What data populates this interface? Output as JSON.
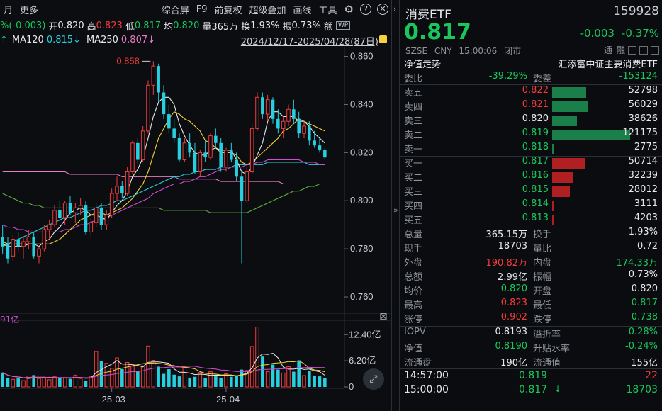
{
  "toolbar": {
    "left": [
      "月",
      "更多"
    ],
    "right": [
      "综合屏",
      "F9",
      "前复权",
      "超级叠加",
      "画线",
      "工具"
    ]
  },
  "ohlc": {
    "chg": "%(-0.003)",
    "open_label": "开",
    "open": "0.820",
    "high_label": "高",
    "high": "0.823",
    "low_label": "低",
    "low": "0.817",
    "avg_label": "均",
    "avg": "0.820",
    "vol_label": "量",
    "vol": "365万",
    "turn_label": "换",
    "turn": "1.93%",
    "amp_label": "振",
    "amp": "0.73%",
    "amt_label": "额"
  },
  "ma": {
    "arrow": "↑",
    "ma120_label": "MA120",
    "ma120": "0.815↓",
    "ma250_label": "MA250",
    "ma250": "0.807↓"
  },
  "date_range": "2024/12/17-2025/04/28(87日)",
  "colors": {
    "up": "#f23b3b",
    "down": "#25d1e0",
    "green": "#19c75c",
    "bg": "#0b0c0f"
  },
  "chart_data": {
    "type": "candlestick",
    "y_ticks": [
      "0.860",
      "0.840",
      "0.820",
      "0.800",
      "0.780",
      "0.760"
    ],
    "ylim": [
      0.755,
      0.864
    ],
    "max_annotation": "0.858",
    "x_ticks": [
      "25-03",
      "25-04"
    ],
    "candles": [
      [
        0.785,
        0.79,
        0.778,
        0.781
      ],
      [
        0.782,
        0.785,
        0.774,
        0.776
      ],
      [
        0.777,
        0.786,
        0.775,
        0.784
      ],
      [
        0.784,
        0.787,
        0.779,
        0.781
      ],
      [
        0.781,
        0.785,
        0.776,
        0.783
      ],
      [
        0.783,
        0.788,
        0.78,
        0.785
      ],
      [
        0.785,
        0.787,
        0.776,
        0.777
      ],
      [
        0.777,
        0.781,
        0.774,
        0.78
      ],
      [
        0.78,
        0.79,
        0.779,
        0.788
      ],
      [
        0.788,
        0.792,
        0.784,
        0.79
      ],
      [
        0.79,
        0.798,
        0.789,
        0.796
      ],
      [
        0.796,
        0.8,
        0.792,
        0.793
      ],
      [
        0.793,
        0.8,
        0.79,
        0.799
      ],
      [
        0.799,
        0.802,
        0.794,
        0.795
      ],
      [
        0.795,
        0.799,
        0.791,
        0.797
      ],
      [
        0.797,
        0.801,
        0.794,
        0.798
      ],
      [
        0.798,
        0.8,
        0.786,
        0.787
      ],
      [
        0.787,
        0.793,
        0.785,
        0.791
      ],
      [
        0.791,
        0.799,
        0.789,
        0.797
      ],
      [
        0.797,
        0.799,
        0.788,
        0.79
      ],
      [
        0.79,
        0.796,
        0.788,
        0.794
      ],
      [
        0.794,
        0.805,
        0.793,
        0.803
      ],
      [
        0.803,
        0.81,
        0.8,
        0.806
      ],
      [
        0.806,
        0.808,
        0.801,
        0.803
      ],
      [
        0.803,
        0.814,
        0.802,
        0.812
      ],
      [
        0.812,
        0.825,
        0.811,
        0.824
      ],
      [
        0.824,
        0.826,
        0.815,
        0.817
      ],
      [
        0.817,
        0.831,
        0.816,
        0.829
      ],
      [
        0.829,
        0.85,
        0.828,
        0.848
      ],
      [
        0.848,
        0.858,
        0.844,
        0.856
      ],
      [
        0.856,
        0.857,
        0.841,
        0.845
      ],
      [
        0.845,
        0.848,
        0.834,
        0.836
      ],
      [
        0.836,
        0.84,
        0.828,
        0.83
      ],
      [
        0.83,
        0.834,
        0.824,
        0.826
      ],
      [
        0.826,
        0.828,
        0.816,
        0.817
      ],
      [
        0.817,
        0.826,
        0.816,
        0.824
      ],
      [
        0.824,
        0.828,
        0.818,
        0.82
      ],
      [
        0.82,
        0.824,
        0.811,
        0.812
      ],
      [
        0.812,
        0.821,
        0.81,
        0.82
      ],
      [
        0.82,
        0.825,
        0.816,
        0.818
      ],
      [
        0.818,
        0.828,
        0.817,
        0.827
      ],
      [
        0.827,
        0.83,
        0.822,
        0.824
      ],
      [
        0.824,
        0.826,
        0.812,
        0.814
      ],
      [
        0.814,
        0.822,
        0.812,
        0.821
      ],
      [
        0.821,
        0.824,
        0.816,
        0.817
      ],
      [
        0.817,
        0.82,
        0.808,
        0.81
      ],
      [
        0.81,
        0.812,
        0.774,
        0.8
      ],
      [
        0.8,
        0.814,
        0.799,
        0.812
      ],
      [
        0.812,
        0.832,
        0.811,
        0.83
      ],
      [
        0.83,
        0.845,
        0.829,
        0.843
      ],
      [
        0.843,
        0.845,
        0.834,
        0.836
      ],
      [
        0.836,
        0.844,
        0.833,
        0.842
      ],
      [
        0.842,
        0.843,
        0.832,
        0.834
      ],
      [
        0.834,
        0.838,
        0.828,
        0.83
      ],
      [
        0.83,
        0.835,
        0.826,
        0.833
      ],
      [
        0.833,
        0.84,
        0.831,
        0.838
      ],
      [
        0.838,
        0.842,
        0.832,
        0.834
      ],
      [
        0.834,
        0.837,
        0.826,
        0.828
      ],
      [
        0.828,
        0.833,
        0.826,
        0.831
      ],
      [
        0.831,
        0.833,
        0.823,
        0.825
      ],
      [
        0.825,
        0.829,
        0.822,
        0.823
      ],
      [
        0.823,
        0.826,
        0.82,
        0.821
      ],
      [
        0.821,
        0.822,
        0.817,
        0.818
      ]
    ],
    "ma5": [
      0.782,
      0.781,
      0.781,
      0.781,
      0.781,
      0.782,
      0.782,
      0.781,
      0.783,
      0.784,
      0.787,
      0.789,
      0.792,
      0.795,
      0.796,
      0.797,
      0.796,
      0.794,
      0.794,
      0.793,
      0.792,
      0.795,
      0.798,
      0.8,
      0.804,
      0.81,
      0.813,
      0.818,
      0.826,
      0.835,
      0.841,
      0.843,
      0.843,
      0.84,
      0.832,
      0.827,
      0.823,
      0.82,
      0.819,
      0.819,
      0.821,
      0.822,
      0.821,
      0.821,
      0.821,
      0.817,
      0.812,
      0.811,
      0.814,
      0.819,
      0.824,
      0.833,
      0.837,
      0.837,
      0.835,
      0.835,
      0.835,
      0.833,
      0.833,
      0.831,
      0.828,
      0.826,
      0.824
    ],
    "ma10": [
      0.783,
      0.782,
      0.782,
      0.782,
      0.782,
      0.782,
      0.782,
      0.782,
      0.782,
      0.782,
      0.783,
      0.784,
      0.786,
      0.788,
      0.79,
      0.792,
      0.793,
      0.794,
      0.795,
      0.795,
      0.794,
      0.795,
      0.796,
      0.797,
      0.799,
      0.801,
      0.804,
      0.807,
      0.812,
      0.819,
      0.826,
      0.83,
      0.834,
      0.837,
      0.836,
      0.834,
      0.833,
      0.831,
      0.829,
      0.825,
      0.824,
      0.822,
      0.82,
      0.82,
      0.82,
      0.819,
      0.816,
      0.815,
      0.816,
      0.818,
      0.82,
      0.822,
      0.824,
      0.826,
      0.829,
      0.83,
      0.832,
      0.834,
      0.833,
      0.832,
      0.831,
      0.83,
      0.829
    ],
    "ma60": [
      0.79,
      0.789,
      0.789,
      0.788,
      0.788,
      0.787,
      0.787,
      0.787,
      0.787,
      0.787,
      0.787,
      0.787,
      0.788,
      0.788,
      0.789,
      0.79,
      0.79,
      0.791,
      0.792,
      0.792,
      0.793,
      0.794,
      0.795,
      0.796,
      0.797,
      0.798,
      0.799,
      0.8,
      0.801,
      0.803,
      0.804,
      0.805,
      0.806,
      0.807,
      0.807,
      0.808,
      0.808,
      0.809,
      0.81,
      0.81,
      0.811,
      0.812,
      0.813,
      0.813,
      0.814,
      0.814,
      0.814,
      0.815,
      0.815,
      0.816,
      0.816,
      0.817,
      0.817,
      0.817,
      0.817,
      0.817,
      0.817,
      0.817,
      0.816,
      0.816,
      0.816,
      0.815,
      0.815
    ],
    "ma120": [
      0.781,
      0.782,
      0.783,
      0.784,
      0.785,
      0.786,
      0.787,
      0.788,
      0.789,
      0.79,
      0.791,
      0.792,
      0.793,
      0.793,
      0.794,
      0.795,
      0.796,
      0.796,
      0.797,
      0.798,
      0.798,
      0.799,
      0.8,
      0.8,
      0.801,
      0.802,
      0.803,
      0.804,
      0.805,
      0.806,
      0.807,
      0.808,
      0.809,
      0.81,
      0.81,
      0.811,
      0.811,
      0.812,
      0.812,
      0.813,
      0.813,
      0.813,
      0.814,
      0.814,
      0.814,
      0.815,
      0.815,
      0.815,
      0.815,
      0.815,
      0.815,
      0.816,
      0.816,
      0.816,
      0.816,
      0.816,
      0.816,
      0.816,
      0.816,
      0.815,
      0.815,
      0.815,
      0.815
    ],
    "ma250": [
      0.812,
      0.812,
      0.812,
      0.812,
      0.812,
      0.812,
      0.812,
      0.812,
      0.812,
      0.812,
      0.812,
      0.812,
      0.812,
      0.811,
      0.811,
      0.811,
      0.811,
      0.811,
      0.811,
      0.811,
      0.811,
      0.811,
      0.811,
      0.81,
      0.81,
      0.81,
      0.81,
      0.81,
      0.81,
      0.81,
      0.81,
      0.81,
      0.81,
      0.81,
      0.809,
      0.809,
      0.809,
      0.809,
      0.809,
      0.809,
      0.809,
      0.809,
      0.808,
      0.808,
      0.808,
      0.808,
      0.808,
      0.808,
      0.808,
      0.808,
      0.808,
      0.808,
      0.808,
      0.808,
      0.807,
      0.807,
      0.807,
      0.807,
      0.807,
      0.807,
      0.807,
      0.807,
      0.807
    ],
    "ma_green": [
      0.803,
      0.802,
      0.801,
      0.8,
      0.799,
      0.799,
      0.798,
      0.798,
      0.797,
      0.797,
      0.797,
      0.797,
      0.797,
      0.797,
      0.797,
      0.797,
      0.797,
      0.797,
      0.797,
      0.797,
      0.797,
      0.797,
      0.797,
      0.797,
      0.797,
      0.797,
      0.797,
      0.797,
      0.797,
      0.797,
      0.797,
      0.796,
      0.796,
      0.796,
      0.796,
      0.796,
      0.796,
      0.796,
      0.796,
      0.796,
      0.795,
      0.795,
      0.795,
      0.795,
      0.795,
      0.795,
      0.795,
      0.795,
      0.796,
      0.797,
      0.798,
      0.799,
      0.8,
      0.801,
      0.802,
      0.803,
      0.804,
      0.804,
      0.805,
      0.806,
      0.806,
      0.807,
      0.807
    ],
    "vol_label": "91亿",
    "vol_ticks": [
      "12.40亿",
      "6.20亿",
      "0"
    ],
    "volumes": [
      3.4,
      2.2,
      1.8,
      2.0,
      1.5,
      2.6,
      2.8,
      2.0,
      2.3,
      1.7,
      2.4,
      2.1,
      2.2,
      1.9,
      2.8,
      2.0,
      1.4,
      2.5,
      8.4,
      6.1,
      5.6,
      4.4,
      6.9,
      4.2,
      5.8,
      4.9,
      3.8,
      5.0,
      9.7,
      6.3,
      4.8,
      3.1,
      4.2,
      2.9,
      2.5,
      4.6,
      2.2,
      2.4,
      3.4,
      2.1,
      3.6,
      2.5,
      2.2,
      3.1,
      2.4,
      2.6,
      4.1,
      3.9,
      9.6,
      14.2,
      7.2,
      3.6,
      5.3,
      4.1,
      3.3,
      4.8,
      3.6,
      6.3,
      2.7,
      3.8,
      2.7,
      2.5,
      2.1
    ]
  },
  "quote": {
    "name": "消费ETF",
    "code": "159928",
    "price": "0.817",
    "chg": "-0.003",
    "pct": "-0.37%",
    "market": "SZSE",
    "currency": "CNY",
    "time": "15:00:06",
    "status": "闭市",
    "tags": [
      "通",
      "融"
    ],
    "nav_label": "净值走势",
    "fund_name": "汇添富中证主要消费ETF",
    "weibi_label": "委比",
    "weibi": "-39.29%",
    "weicha_label": "委差",
    "weicha": "-153124"
  },
  "sells": [
    {
      "label": "卖五",
      "price": "0.822",
      "qty": "52798",
      "color": "#f23b3b",
      "bar": 0.44
    },
    {
      "label": "卖四",
      "price": "0.821",
      "qty": "56029",
      "color": "#f23b3b",
      "bar": 0.46
    },
    {
      "label": "卖三",
      "price": "0.820",
      "qty": "38626",
      "color": "#e6e8eb",
      "bar": 0.32
    },
    {
      "label": "卖二",
      "price": "0.819",
      "qty": "121175",
      "color": "#19c75c",
      "bar": 1.0
    },
    {
      "label": "卖一",
      "price": "0.818",
      "qty": "2775",
      "color": "#19c75c",
      "bar": 0.02
    }
  ],
  "buys": [
    {
      "label": "买一",
      "price": "0.817",
      "qty": "50714",
      "color": "#19c75c",
      "bar": 0.42
    },
    {
      "label": "买二",
      "price": "0.816",
      "qty": "32239",
      "color": "#19c75c",
      "bar": 0.27
    },
    {
      "label": "买三",
      "price": "0.815",
      "qty": "28012",
      "color": "#19c75c",
      "bar": 0.23
    },
    {
      "label": "买四",
      "price": "0.814",
      "qty": "3111",
      "color": "#19c75c",
      "bar": 0.03
    },
    {
      "label": "买五",
      "price": "0.813",
      "qty": "4203",
      "color": "#19c75c",
      "bar": 0.03
    }
  ],
  "stats": [
    {
      "l1": "总量",
      "v1": "365.15万",
      "c1": "#e6e8eb",
      "l2": "换手",
      "v2": "1.93%",
      "c2": "#e6e8eb"
    },
    {
      "l1": "现手",
      "v1": "18703",
      "c1": "#e6e8eb",
      "l2": "量比",
      "v2": "0.72",
      "c2": "#e6e8eb"
    },
    {
      "l1": "外盘",
      "v1": "190.82万",
      "c1": "#f23b3b",
      "l2": "内盘",
      "v2": "174.33万",
      "c2": "#19c75c"
    },
    {
      "l1": "总额",
      "v1": "2.99亿",
      "c1": "#e6e8eb",
      "l2": "振幅",
      "v2": "0.73%",
      "c2": "#e6e8eb"
    },
    {
      "l1": "均价",
      "v1": "0.820",
      "c1": "#19c75c",
      "l2": "开盘",
      "v2": "0.820",
      "c2": "#e6e8eb"
    },
    {
      "l1": "最高",
      "v1": "0.823",
      "c1": "#f23b3b",
      "l2": "最低",
      "v2": "0.817",
      "c2": "#19c75c"
    },
    {
      "l1": "涨停",
      "v1": "0.902",
      "c1": "#f23b3b",
      "l2": "跌停",
      "v2": "0.738",
      "c2": "#19c75c"
    },
    {
      "l1": "IOPV",
      "v1": "0.8193",
      "c1": "#e6e8eb",
      "l2": "溢折率",
      "v2": "-0.28%",
      "c2": "#19c75c"
    },
    {
      "l1": "净值",
      "v1": "0.8190",
      "c1": "#19c75c",
      "l2": "升贴水率",
      "v2": "-0.24%",
      "c2": "#19c75c"
    },
    {
      "l1": "流通盘",
      "v1": "190亿",
      "c1": "#e6e8eb",
      "l2": "流通值",
      "v2": "155亿",
      "c2": "#e6e8eb"
    }
  ],
  "ticks": [
    {
      "time": "14:57:00",
      "price": "0.819",
      "arrow": "",
      "qty": "22",
      "pcolor": "#19c75c",
      "qcolor": "#f23b3b"
    },
    {
      "time": "15:00:00",
      "price": "0.817",
      "arrow": "↓",
      "qty": "18703",
      "pcolor": "#19c75c",
      "qcolor": "#19c75c"
    }
  ]
}
